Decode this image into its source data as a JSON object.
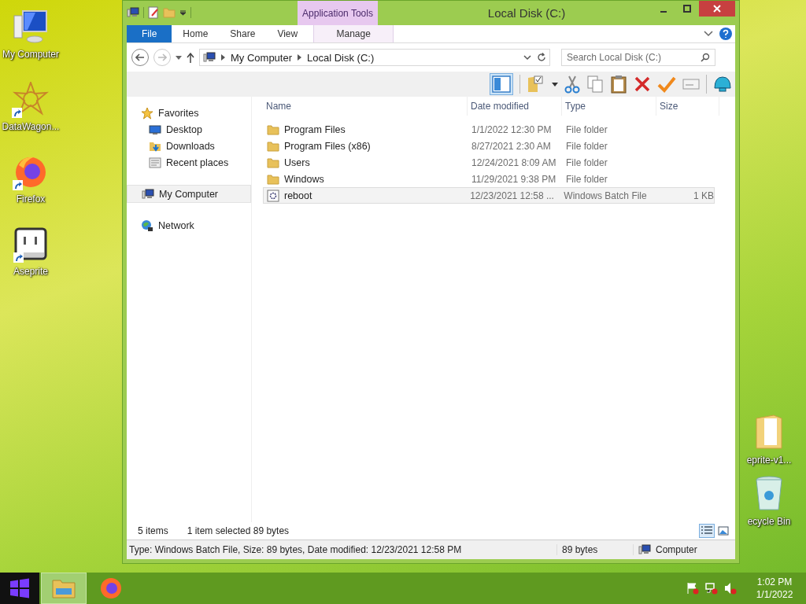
{
  "desktop_left": [
    {
      "label": "My Computer",
      "kind": "computer",
      "shortcut": false
    },
    {
      "label": "DataWagon...",
      "kind": "star",
      "shortcut": true
    },
    {
      "label": "Firefox",
      "kind": "firefox",
      "shortcut": true
    },
    {
      "label": "Aseprite",
      "kind": "aseprite",
      "shortcut": true
    }
  ],
  "desktop_right": [
    {
      "label": "eprite-v1...",
      "kind": "folder"
    },
    {
      "label": "ecycle Bin",
      "kind": "bin"
    }
  ],
  "window": {
    "title": "Local Disk (C:)",
    "contextual_group": "Application Tools",
    "ribbon_tabs": [
      {
        "label": "File",
        "kind": "file",
        "selected": false
      },
      {
        "label": "Home",
        "kind": "tab",
        "selected": false
      },
      {
        "label": "Share",
        "kind": "tab",
        "selected": false
      },
      {
        "label": "View",
        "kind": "tab",
        "selected": false
      },
      {
        "label": "Manage",
        "kind": "contextual",
        "selected": false
      }
    ],
    "address": [
      "My Computer",
      "Local Disk (C:)"
    ],
    "search": {
      "placeholder": "Search Local Disk (C:)"
    },
    "nav": [
      {
        "label": "Favorites",
        "kind": "star",
        "selected": false,
        "children": [
          {
            "label": "Desktop",
            "kind": "desktop",
            "selected": false
          },
          {
            "label": "Downloads",
            "kind": "downloads",
            "selected": false
          },
          {
            "label": "Recent places",
            "kind": "recent",
            "selected": false
          }
        ]
      },
      {
        "label": "My Computer",
        "kind": "computer",
        "selected": true
      },
      {
        "label": "Network",
        "kind": "network",
        "selected": false
      }
    ],
    "columns": [
      "Name",
      "Date modified",
      "Type",
      "Size"
    ],
    "rows": [
      {
        "name": "Program Files",
        "date": "1/1/2022 12:30 PM",
        "type": "File folder",
        "kind": "folder",
        "selected": false
      },
      {
        "name": "Program Files (x86)",
        "date": "8/27/2021 2:30 AM",
        "type": "File folder",
        "kind": "folder",
        "selected": false
      },
      {
        "name": "Users",
        "date": "12/24/2021 8:09 AM",
        "type": "File folder",
        "kind": "folder",
        "selected": false
      },
      {
        "name": "Windows",
        "date": "11/29/2021 9:38 PM",
        "type": "File folder",
        "kind": "folder",
        "selected": false
      },
      {
        "name": "reboot",
        "date": "12/23/2021 12:58 ...",
        "type": "Windows Batch File",
        "size": "1 KB",
        "kind": "batch",
        "selected": true
      }
    ],
    "status": {
      "count": "5 items",
      "selection": "1 item selected  89 bytes"
    },
    "details_bar": {
      "info": "Type: Windows Batch File, Size: 89 bytes, Date modified: 12/23/2021 12:58 PM",
      "size": "89 bytes",
      "location": "Computer"
    }
  },
  "taskbar": {
    "apps": [
      {
        "kind": "explorer",
        "selected": true
      },
      {
        "kind": "firefox",
        "selected": false
      }
    ],
    "time": "1:02 PM",
    "date": "1/1/2022"
  }
}
